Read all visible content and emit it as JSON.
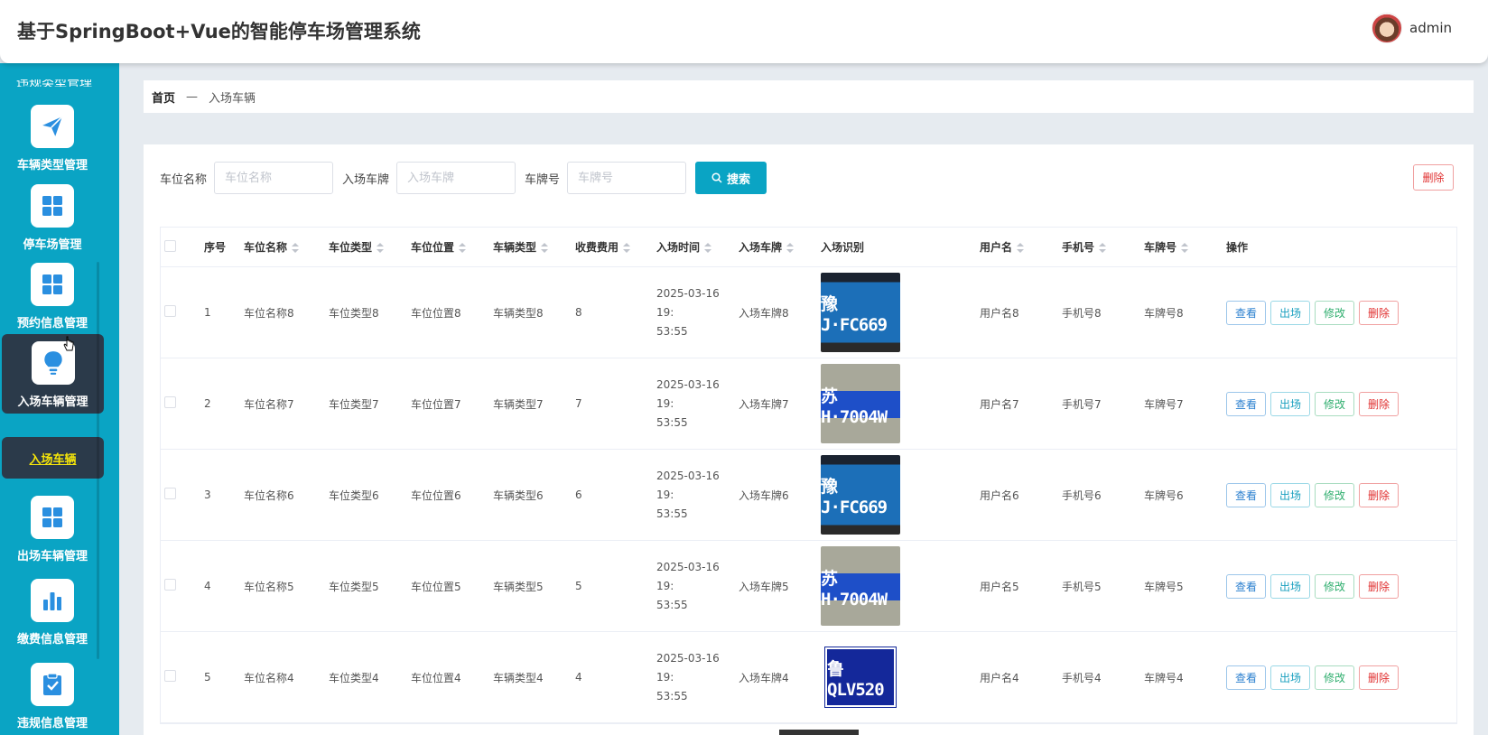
{
  "header": {
    "title": "基于SpringBoot+Vue的智能停车场管理系统",
    "username": "admin"
  },
  "sidebar": {
    "cut_label": "违规类型管理",
    "items": [
      {
        "label": "车辆类型管理",
        "icon": "paper-plane-icon"
      },
      {
        "label": "停车场管理",
        "icon": "grid-icon"
      },
      {
        "label": "预约信息管理",
        "icon": "grid-icon"
      },
      {
        "label": "入场车辆管理",
        "icon": "bulb-icon"
      },
      {
        "label": "出场车辆管理",
        "icon": "grid-icon"
      },
      {
        "label": "缴费信息管理",
        "icon": "bar-chart-icon"
      },
      {
        "label": "违规信息管理",
        "icon": "clipboard-check-icon"
      }
    ],
    "sub_item": "入场车辆"
  },
  "breadcrumb": {
    "home": "首页",
    "sep": "—",
    "current": "入场车辆"
  },
  "search": {
    "f1_label": "车位名称",
    "f1_placeholder": "车位名称",
    "f2_label": "入场车牌",
    "f2_placeholder": "入场车牌",
    "f3_label": "车牌号",
    "f3_placeholder": "车牌号",
    "button": "搜索",
    "delete_button": "删除"
  },
  "table": {
    "headers": [
      "序号",
      "车位名称",
      "车位类型",
      "车位位置",
      "车辆类型",
      "收费费用",
      "入场时间",
      "入场车牌",
      "入场识别",
      "用户名",
      "手机号",
      "车牌号",
      "操作"
    ],
    "rows": [
      {
        "no": "1",
        "name": "车位名称8",
        "type": "车位类型8",
        "pos": "车位位置8",
        "vtype": "车辆类型8",
        "fee": "8",
        "time_a": "2025-03-16 19:",
        "time_b": "53:55",
        "plate_in": "入场车牌8",
        "img_text": "豫J·FC669",
        "user": "用户名8",
        "phone": "手机号8",
        "plate_no": "车牌号8"
      },
      {
        "no": "2",
        "name": "车位名称7",
        "type": "车位类型7",
        "pos": "车位位置7",
        "vtype": "车辆类型7",
        "fee": "7",
        "time_a": "2025-03-16 19:",
        "time_b": "53:55",
        "plate_in": "入场车牌7",
        "img_text": "苏H·7004W",
        "user": "用户名7",
        "phone": "手机号7",
        "plate_no": "车牌号7"
      },
      {
        "no": "3",
        "name": "车位名称6",
        "type": "车位类型6",
        "pos": "车位位置6",
        "vtype": "车辆类型6",
        "fee": "6",
        "time_a": "2025-03-16 19:",
        "time_b": "53:55",
        "plate_in": "入场车牌6",
        "img_text": "豫J·FC669",
        "user": "用户名6",
        "phone": "手机号6",
        "plate_no": "车牌号6"
      },
      {
        "no": "4",
        "name": "车位名称5",
        "type": "车位类型5",
        "pos": "车位位置5",
        "vtype": "车辆类型5",
        "fee": "5",
        "time_a": "2025-03-16 19:",
        "time_b": "53:55",
        "plate_in": "入场车牌5",
        "img_text": "苏H·7004W",
        "user": "用户名5",
        "phone": "手机号5",
        "plate_no": "车牌号5"
      },
      {
        "no": "5",
        "name": "车位名称4",
        "type": "车位类型4",
        "pos": "车位位置4",
        "vtype": "车辆类型4",
        "fee": "4",
        "time_a": "2025-03-16 19:",
        "time_b": "53:55",
        "plate_in": "入场车牌4",
        "img_text": "鲁QLV520",
        "user": "用户名4",
        "phone": "手机号4",
        "plate_no": "车牌号4"
      }
    ],
    "ops": {
      "view": "查看",
      "out": "出场",
      "edit": "修改",
      "del": "删除"
    }
  },
  "colors": {
    "sidebar": "#0aa4c4",
    "active": "#2b3a4a",
    "primary": "#0aa4c4",
    "danger": "#e03030"
  }
}
